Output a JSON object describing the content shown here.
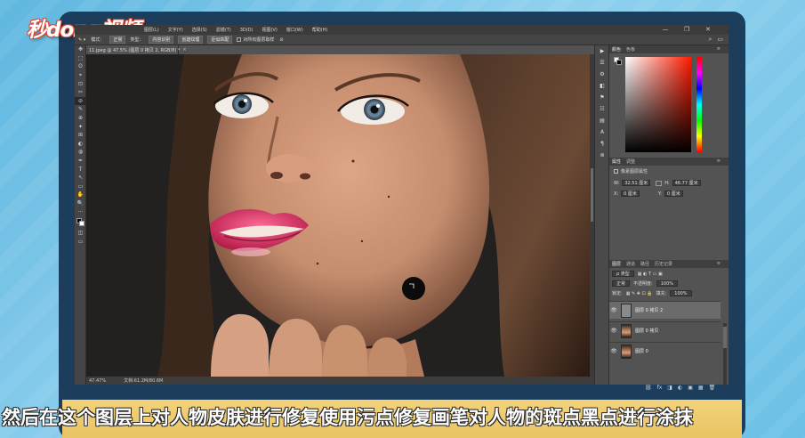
{
  "watermark": {
    "logo": "秒dong视频"
  },
  "menubar": {
    "items": [
      "图层(L)",
      "文字(Y)",
      "选择(S)",
      "滤镜(T)",
      "3D(D)",
      "视图(V)",
      "窗口(W)",
      "帮助(H)"
    ],
    "minimize": "—",
    "restore": "❐",
    "close": "✕"
  },
  "optionsbar": {
    "mode_label": "模式：",
    "mode_value": "正常",
    "type_label": "类型：",
    "type_options": [
      "内容识别",
      "创建纹理",
      "近似匹配"
    ],
    "sample_all_label": "对所有图层取样",
    "search_icon": "⌕",
    "workspace_icon": "▭"
  },
  "document": {
    "tab_title": "11.jpeg @ 47.5% (图层 0 拷贝 2, RGB/8) *",
    "close": "×",
    "zoom": "47.47%",
    "doc_info": "文档:61.2M/80.6M"
  },
  "tools": [
    "✥",
    "⬚",
    "ʘ",
    "⌖",
    "⊡",
    "✂",
    "⊘",
    "✎",
    "⊕",
    "✦",
    "⊞",
    "◐",
    "◍",
    "✒",
    "T",
    "↖",
    "▭",
    "✋",
    "🔍",
    "···"
  ],
  "dock_icons": [
    "▶",
    "☰",
    "⚙",
    "◧",
    "⚑",
    "☷",
    "▤",
    "A",
    "¶",
    "⊛"
  ],
  "color_panel": {
    "tabs": [
      "颜色",
      "色板"
    ],
    "menu_icon": "≡"
  },
  "properties_panel": {
    "tabs": [
      "属性",
      "调整"
    ],
    "title": "像素图层属性",
    "w_label": "W:",
    "w_value": "32.51 厘米",
    "h_label": "H:",
    "h_value": "46.77 厘米",
    "x_label": "X:",
    "x_value": "0 厘米",
    "y_label": "Y:",
    "y_value": "0 厘米",
    "menu_icon": "≡"
  },
  "layers_panel": {
    "tabs": [
      "图层",
      "通道",
      "路径",
      "历史记录"
    ],
    "kind_label": "ρ 类型",
    "blend_mode": "正常",
    "opacity_label": "不透明度:",
    "opacity_value": "100%",
    "lock_label": "锁定:",
    "fill_label": "填充:",
    "fill_value": "100%",
    "eye_icon": "👁",
    "layers": [
      {
        "name": "图层 0 拷贝 2",
        "selected": true,
        "thumb": "gray"
      },
      {
        "name": "图层 0 拷贝",
        "selected": false,
        "thumb": "face"
      },
      {
        "name": "图层 0",
        "selected": false,
        "thumb": "face"
      }
    ],
    "footer_icons": [
      "⛓",
      "fx",
      "◨",
      "◐",
      "▣",
      "▦",
      "🗑"
    ],
    "menu_icon": "≡"
  },
  "subtitle": "然后在这个图层上对人物皮肤进行修复使用污点修复画笔对人物的斑点黑点进行涂抹"
}
